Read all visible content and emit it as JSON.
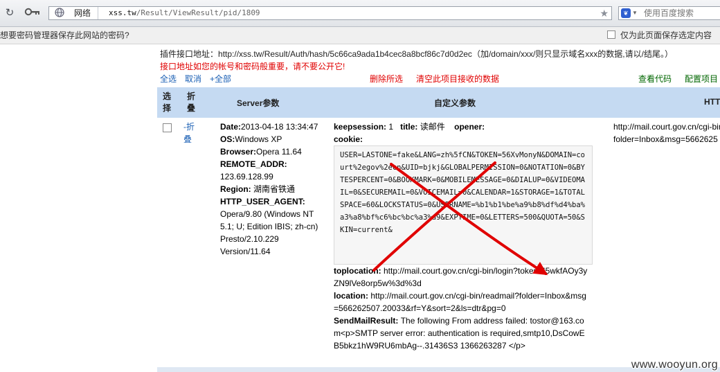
{
  "browser": {
    "site_label": "网络",
    "url_host": "xss.tw",
    "url_path": "/Result/ViewResult/pid/1809",
    "search_placeholder": "使用百度搜索",
    "icons": [
      "refresh-icon",
      "key-icon",
      "globe-icon",
      "star-icon",
      "baidu-icon",
      "chevron-down-icon"
    ]
  },
  "password_bar": {
    "prompt": "想要密码管理器保存此网站的密码?",
    "checkbox_label": "仅为此页面保存选定内容"
  },
  "api": {
    "label": "插件接口地址：",
    "url": "http://xss.tw/Result/Auth/hash/5c66ca9ada1b4cec8a8bcf86c7d0d2ec",
    "note": "（加/domain/xxx/则只显示域名xxx的数据,请以/结尾。）"
  },
  "warning": "接口地址如您的帐号和密码般重要，请不要公开它!",
  "actions": {
    "select_all": "全选",
    "cancel": "取消",
    "plus_all": "+全部",
    "delete_selected": "删除所选",
    "clear_data": "清空此项目接收的数据",
    "view_code": "查看代码",
    "config_project": "配置项目"
  },
  "table": {
    "headers": {
      "select": "选择",
      "fold": "折叠",
      "server": "Server参数",
      "custom": "自定义参数",
      "http": "HTT"
    },
    "row": {
      "fold_toggle": "-折叠",
      "server": {
        "date_key": "Date:",
        "date_val": "2013-04-18 13:34:47",
        "os_key": "OS:",
        "os_val": "Windows XP",
        "browser_key": "Browser:",
        "browser_val": "Opera 11.64",
        "remote_key": "REMOTE_ADDR:",
        "remote_val": "123.69.128.99",
        "region_key": "Region:",
        "region_val": "湖南省铁通",
        "ua_key": "HTTP_USER_AGENT:",
        "ua_val": "Opera/9.80 (Windows NT 5.1; U; Edition IBIS; zh-cn) Presto/2.10.229 Version/11.64"
      },
      "custom": {
        "keepsession_key": "keepsession:",
        "keepsession_val": "1",
        "title_key": "title:",
        "title_val": "读邮件",
        "opener_key": "opener:",
        "cookie_key": "cookie:",
        "cookie_val": "USER=LASTONE=fake&LANG=zh%5fCN&TOKEN=56XvMonyN&DOMAIN=court%2egov%2ecn&UID=bjkj&GLOBALPERMISSION=0&NOTATION=0&BYTESPERCENT=0&BOOKMARK=0&MOBILEMESSAGE=0&DIALUP=0&VIDEOMAIL=0&SECUREMAIL=0&VOICEMAIL=0&CALENDAR=1&STORAGE=1&TOTALSPACE=60&LOCKSTATUS=0&USERNAME=%b1%b1%be%a9%b8%df%d4%ba%a3%a8%bf%c6%bc%bc%a3%a9&EXPTIME=0&LETTERS=500&QUOTA=50&SKIN=current&",
        "toplocation_key": "toplocation:",
        "toplocation_val": "http://mail.court.gov.cn/cgi-bin/login?token=I5wkfAOy3yZN9lVe8orp5w%3d%3d",
        "location_key": "location:",
        "location_val": "http://mail.court.gov.cn/cgi-bin/readmail?folder=Inbox&msg=566262507.20033&rf=Y&sort=2&ls=dtr&pg=0",
        "sendmail_key": "SendMailResult:",
        "sendmail_val": "The following From address failed: tostor@163.com<p>SMTP server error: authentication is required,smtp10,DsCowEB5bkz1hW9RU6mbAg--.31436S3 1366263287 </p>"
      },
      "http": {
        "line1": "http://mail.court.gov.cn/cgi-bin",
        "line2": "folder=Inbox&msg=5662625"
      }
    }
  },
  "watermark": "www.wooyun.org",
  "colors": {
    "header_bg": "#c5daf2",
    "warning_red": "#e00000",
    "link_blue": "#1a5fb4",
    "link_green": "#006600",
    "annotation_red": "#e00000"
  }
}
